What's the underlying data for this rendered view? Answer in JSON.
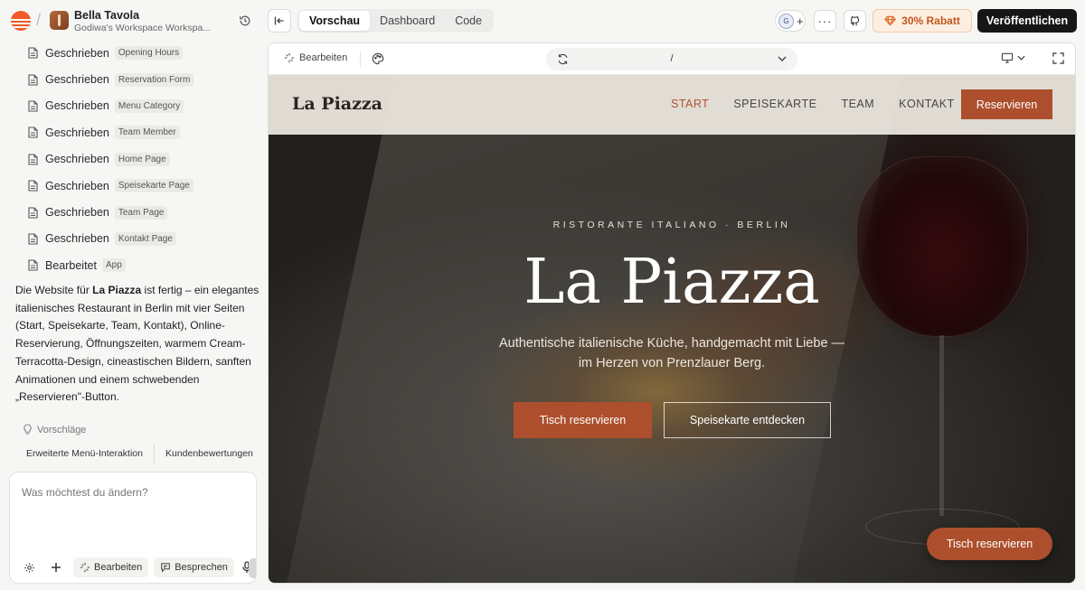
{
  "project": {
    "name": "Bella Tavola",
    "workspace": "Godiwa's Workspace Workspa..."
  },
  "log": [
    {
      "verb": "Geschrieben",
      "target": "Opening Hours"
    },
    {
      "verb": "Geschrieben",
      "target": "Reservation Form"
    },
    {
      "verb": "Geschrieben",
      "target": "Menu Category"
    },
    {
      "verb": "Geschrieben",
      "target": "Team Member"
    },
    {
      "verb": "Geschrieben",
      "target": "Home Page"
    },
    {
      "verb": "Geschrieben",
      "target": "Speisekarte Page"
    },
    {
      "verb": "Geschrieben",
      "target": "Team Page"
    },
    {
      "verb": "Geschrieben",
      "target": "Kontakt Page"
    },
    {
      "verb": "Bearbeitet",
      "target": "App"
    }
  ],
  "message": {
    "before": "Die Website für ",
    "bold": "La Piazza",
    "after": " ist fertig – ein elegantes italienisches Restaurant in Berlin mit vier Seiten (Start, Speisekarte, Team, Kontakt), Online-Reservierung, Öffnungszeiten, warmem Cream-Terracotta-Design, cineastischen Bildern, sanften Animationen und einem schwebenden „Reservieren\"-Button."
  },
  "suggestions": {
    "label": "Vorschläge",
    "items": [
      "Erweiterte Menü-Interaktion",
      "Kundenbewertungen"
    ]
  },
  "composer": {
    "placeholder": "Was möchtest du ändern?",
    "edit_label": "Bearbeiten",
    "talk_label": "Besprechen"
  },
  "topbar": {
    "tabs": [
      "Vorschau",
      "Dashboard",
      "Code"
    ],
    "active_tab": "Vorschau",
    "collab_initial": "G",
    "collab_add": "+",
    "more": "···",
    "promo_label": "30% Rabatt",
    "publish_label": "Veröffentlichen"
  },
  "preview_toolbar": {
    "edit_label": "Bearbeiten",
    "url": "/"
  },
  "site": {
    "logo": "La Piazza",
    "nav": [
      "START",
      "SPEISEKARTE",
      "TEAM",
      "KONTAKT"
    ],
    "active_nav": "START",
    "nav_cta": "Reservieren",
    "kicker": "RISTORANTE ITALIANO · BERLIN",
    "title": "La Piazza",
    "subtitle": "Authentische italienische Küche, handgemacht mit Liebe — im Herzen von Prenzlauer Berg.",
    "primary_cta": "Tisch reservieren",
    "secondary_cta": "Speisekarte entdecken",
    "floating_cta": "Tisch reservieren"
  },
  "colors": {
    "accent": "#ad4f2c",
    "brand_logo": "#f15a24",
    "promo": "#c4571d",
    "publish_bg": "#161616"
  }
}
